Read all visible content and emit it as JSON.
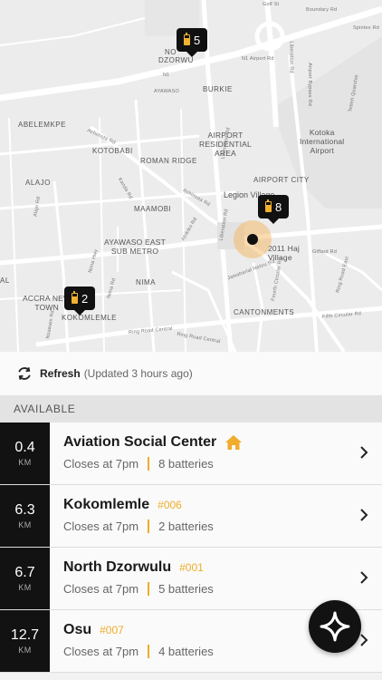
{
  "map": {
    "labels": [
      {
        "id": "nd-top",
        "text": "NO"
      },
      {
        "id": "nd-bottom",
        "text": "DZORWU"
      },
      {
        "id": "ayawaso",
        "text": "AYAWASO"
      },
      {
        "id": "burkie",
        "text": "BURKIE"
      },
      {
        "id": "abelemkpe",
        "text": "ABELEMKPE"
      },
      {
        "id": "airport-res",
        "text": "AIRPORT\nRESIDENTIAL\nAREA"
      },
      {
        "id": "kotoka",
        "text": "Kotoka\nInternational\nAirport"
      },
      {
        "id": "kotobabi",
        "text": "KOTOBABI"
      },
      {
        "id": "roman-ridge",
        "text": "ROMAN RIDGE"
      },
      {
        "id": "alajo",
        "text": "ALAJO"
      },
      {
        "id": "airport-city",
        "text": "AIRPORT CITY"
      },
      {
        "id": "legion",
        "text": "Legion Village"
      },
      {
        "id": "maamobi",
        "text": "MAAMOBI"
      },
      {
        "id": "ayawaso-east",
        "text": "AYAWASO EAST\nSUB METRO"
      },
      {
        "id": "haj",
        "text": "2011 Haj\nVillage"
      },
      {
        "id": "nima",
        "text": "NIMA"
      },
      {
        "id": "al",
        "text": "AL"
      },
      {
        "id": "accra-new-town",
        "text": "ACCRA NEW\nTOWN"
      },
      {
        "id": "kokomlemle-map",
        "text": "KOKOMLEMLE"
      },
      {
        "id": "cantonments",
        "text": "CANTONMENTS"
      }
    ],
    "road_labels": [
      {
        "id": "r1",
        "text": "Golf St"
      },
      {
        "id": "r2",
        "text": "Boundary Rd"
      },
      {
        "id": "r3",
        "text": "Spintex Rd"
      },
      {
        "id": "r4",
        "text": "N1"
      },
      {
        "id": "r5",
        "text": "N1 Airport Rd"
      },
      {
        "id": "r6",
        "text": "Liberation Rd"
      },
      {
        "id": "r7",
        "text": "Airport Bypass Rd"
      },
      {
        "id": "r8",
        "text": "Achimota Rd"
      },
      {
        "id": "r9",
        "text": "Achimota Rd"
      },
      {
        "id": "r10",
        "text": "Liberation Rd"
      },
      {
        "id": "r11",
        "text": "Giffard Rd"
      },
      {
        "id": "r12",
        "text": "Fourth Circular Rd"
      },
      {
        "id": "r13",
        "text": "Jawaharlal Nehru Rd"
      },
      {
        "id": "r14",
        "text": "Ring Road Central"
      },
      {
        "id": "r15",
        "text": "Fifth Circular Rd"
      },
      {
        "id": "r16",
        "text": "Nsawam Rd"
      },
      {
        "id": "r17",
        "text": "Alajo Rd"
      },
      {
        "id": "r18",
        "text": "Kanda Rd"
      },
      {
        "id": "r19",
        "text": "Nima Hwy"
      },
      {
        "id": "r20",
        "text": "Afrikiko Rd"
      },
      {
        "id": "r21",
        "text": "Ring Road Central"
      },
      {
        "id": "r22",
        "text": "Tetteh Quarshie"
      },
      {
        "id": "r23",
        "text": "Ring Road East"
      },
      {
        "id": "r24",
        "text": "Nima Rd"
      },
      {
        "id": "r25",
        "text": "Liberation Rd"
      }
    ],
    "pins": [
      {
        "id": "pin-north-dzorwulu",
        "count": "5"
      },
      {
        "id": "pin-aviation",
        "count": "8"
      },
      {
        "id": "pin-kokomlemle",
        "count": "2"
      }
    ]
  },
  "refresh": {
    "label": "Refresh",
    "updated": "(Updated 3 hours ago)"
  },
  "section": {
    "title": "AVAILABLE"
  },
  "stations": [
    {
      "distance": "0.4",
      "unit": "KM",
      "name": "Aviation Social Center",
      "code": "",
      "home": true,
      "closes": "Closes at 7pm",
      "batteries": "8 batteries"
    },
    {
      "distance": "6.3",
      "unit": "KM",
      "name": "Kokomlemle",
      "code": "#006",
      "home": false,
      "closes": "Closes at 7pm",
      "batteries": "2 batteries"
    },
    {
      "distance": "6.7",
      "unit": "KM",
      "name": "North Dzorwulu",
      "code": "#001",
      "home": false,
      "closes": "Closes at 7pm",
      "batteries": "5 batteries"
    },
    {
      "distance": "12.7",
      "unit": "KM",
      "name": "Osu",
      "code": "#007",
      "home": false,
      "closes": "Closes at 7pm",
      "batteries": "4 batteries"
    }
  ],
  "colors": {
    "accent": "#f0ac2a",
    "dark": "#121212"
  },
  "icons": {
    "refresh": "refresh-icon",
    "home": "home-icon",
    "chevron": "chevron-right-icon",
    "battery": "battery-icon",
    "fab": "star-logo-icon"
  }
}
